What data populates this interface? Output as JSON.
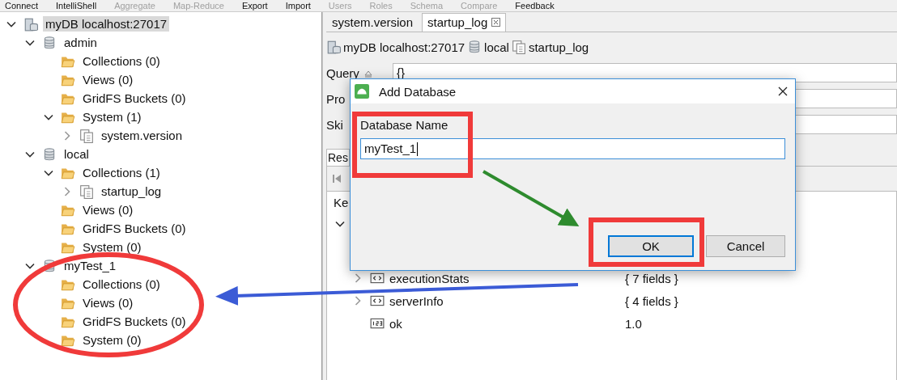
{
  "menu": [
    {
      "label": "Connect",
      "disabled": false
    },
    {
      "label": "IntelliShell",
      "disabled": false
    },
    {
      "label": "Aggregate",
      "disabled": true
    },
    {
      "label": "Map-Reduce",
      "disabled": true
    },
    {
      "label": "Export",
      "disabled": false
    },
    {
      "label": "Import",
      "disabled": false
    },
    {
      "label": "Users",
      "disabled": true
    },
    {
      "label": "Roles",
      "disabled": true
    },
    {
      "label": "Schema",
      "disabled": true
    },
    {
      "label": "Compare",
      "disabled": true
    },
    {
      "label": "Feedback",
      "disabled": false
    }
  ],
  "tree": {
    "kind": "server",
    "label": "myDB localhost:27017",
    "selected": true,
    "expanded": true,
    "children": [
      {
        "kind": "database",
        "label": "admin",
        "selected": false,
        "expanded": true,
        "children": [
          {
            "kind": "folder",
            "label": "Collections (0)",
            "selected": false
          },
          {
            "kind": "folder",
            "label": "Views (0)",
            "selected": false
          },
          {
            "kind": "folder",
            "label": "GridFS Buckets (0)",
            "selected": false
          },
          {
            "kind": "folder",
            "label": "System (1)",
            "selected": false,
            "expanded": true,
            "children": [
              {
                "kind": "collection",
                "label": "system.version",
                "selected": false,
                "expanded": false
              }
            ]
          }
        ]
      },
      {
        "kind": "database",
        "label": "local",
        "selected": false,
        "expanded": true,
        "children": [
          {
            "kind": "folder",
            "label": "Collections (1)",
            "selected": false,
            "expanded": true,
            "children": [
              {
                "kind": "collection",
                "label": "startup_log",
                "selected": false,
                "expanded": false
              }
            ]
          },
          {
            "kind": "folder",
            "label": "Views (0)",
            "selected": false
          },
          {
            "kind": "folder",
            "label": "GridFS Buckets (0)",
            "selected": false
          },
          {
            "kind": "folder",
            "label": "System (0)",
            "selected": false
          }
        ]
      },
      {
        "kind": "database",
        "label": "myTest_1",
        "selected": false,
        "expanded": true,
        "children": [
          {
            "kind": "folder",
            "label": "Collections (0)",
            "selected": false
          },
          {
            "kind": "folder",
            "label": "Views (0)",
            "selected": false
          },
          {
            "kind": "folder",
            "label": "GridFS Buckets (0)",
            "selected": false
          },
          {
            "kind": "folder",
            "label": "System (0)",
            "selected": false
          }
        ]
      }
    ]
  },
  "editor_tabs": [
    {
      "label": "system.version",
      "selected": false,
      "closable": false
    },
    {
      "label": "startup_log",
      "selected": true,
      "closable": true
    }
  ],
  "breadcrumb": [
    {
      "kind": "server",
      "label": "myDB localhost:27017"
    },
    {
      "kind": "database",
      "label": "local"
    },
    {
      "kind": "collection",
      "label": "startup_log"
    }
  ],
  "query_fields": [
    {
      "label": "Query",
      "value": "{}"
    },
    {
      "label": "Pro"
    },
    {
      "label": "Ski"
    }
  ],
  "result_tabs": [
    {
      "label": "Res"
    }
  ],
  "results": {
    "columns": [
      "Ke"
    ],
    "rows": [
      {
        "kind": "document",
        "expanded": true
      },
      {
        "kind": "object",
        "key": "executionStats",
        "value": "{ 7 fields }",
        "expanded": false
      },
      {
        "kind": "object",
        "key": "serverInfo",
        "value": "{ 4 fields }",
        "expanded": false
      },
      {
        "kind": "number",
        "key": "ok",
        "value": "1.0"
      }
    ]
  },
  "dialog": {
    "title": "Add Database",
    "field_label": "Database Name",
    "field_value": "myTest_1",
    "buttons": [
      {
        "label": "OK",
        "focused": true
      },
      {
        "label": "Cancel",
        "focused": false
      }
    ]
  }
}
